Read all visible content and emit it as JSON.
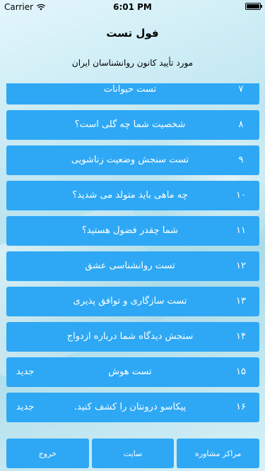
{
  "status_bar": {
    "carrier": "Carrier",
    "time": "6:01 PM",
    "battery_level": 1.0
  },
  "header": {
    "title": "فول تست",
    "subtitle": "مورد تأیید کانون روانشناسان ایران"
  },
  "tests": [
    {
      "number": "۷",
      "label": "تست حیوانات",
      "badge": ""
    },
    {
      "number": "۸",
      "label": "شخصیت شما چه گلی است؟",
      "badge": ""
    },
    {
      "number": "۹",
      "label": "تست سنجش وضعیت زناشویی",
      "badge": ""
    },
    {
      "number": "۱۰",
      "label": "چه ماهی باید متولد می شدید؟",
      "badge": ""
    },
    {
      "number": "۱۱",
      "label": "شما چقدر فضول هستید؟",
      "badge": ""
    },
    {
      "number": "۱۲",
      "label": "تست روانشناسی عشق",
      "badge": ""
    },
    {
      "number": "۱۳",
      "label": "تست سازگاری و توافق پذیری",
      "badge": ""
    },
    {
      "number": "۱۴",
      "label": "سنجش دیدگاه شما درباره ازدواج",
      "badge": ""
    },
    {
      "number": "۱۵",
      "label": "تست هوش",
      "badge": "جدید"
    },
    {
      "number": "۱۶",
      "label": "پیکاسو درونتان را کشف کنید.",
      "badge": "جدید"
    }
  ],
  "bottom_buttons": {
    "exit": "خروج",
    "site": "سایت",
    "counseling": "مراکز مشاوره"
  },
  "colors": {
    "accent": "#2ea8f5"
  }
}
